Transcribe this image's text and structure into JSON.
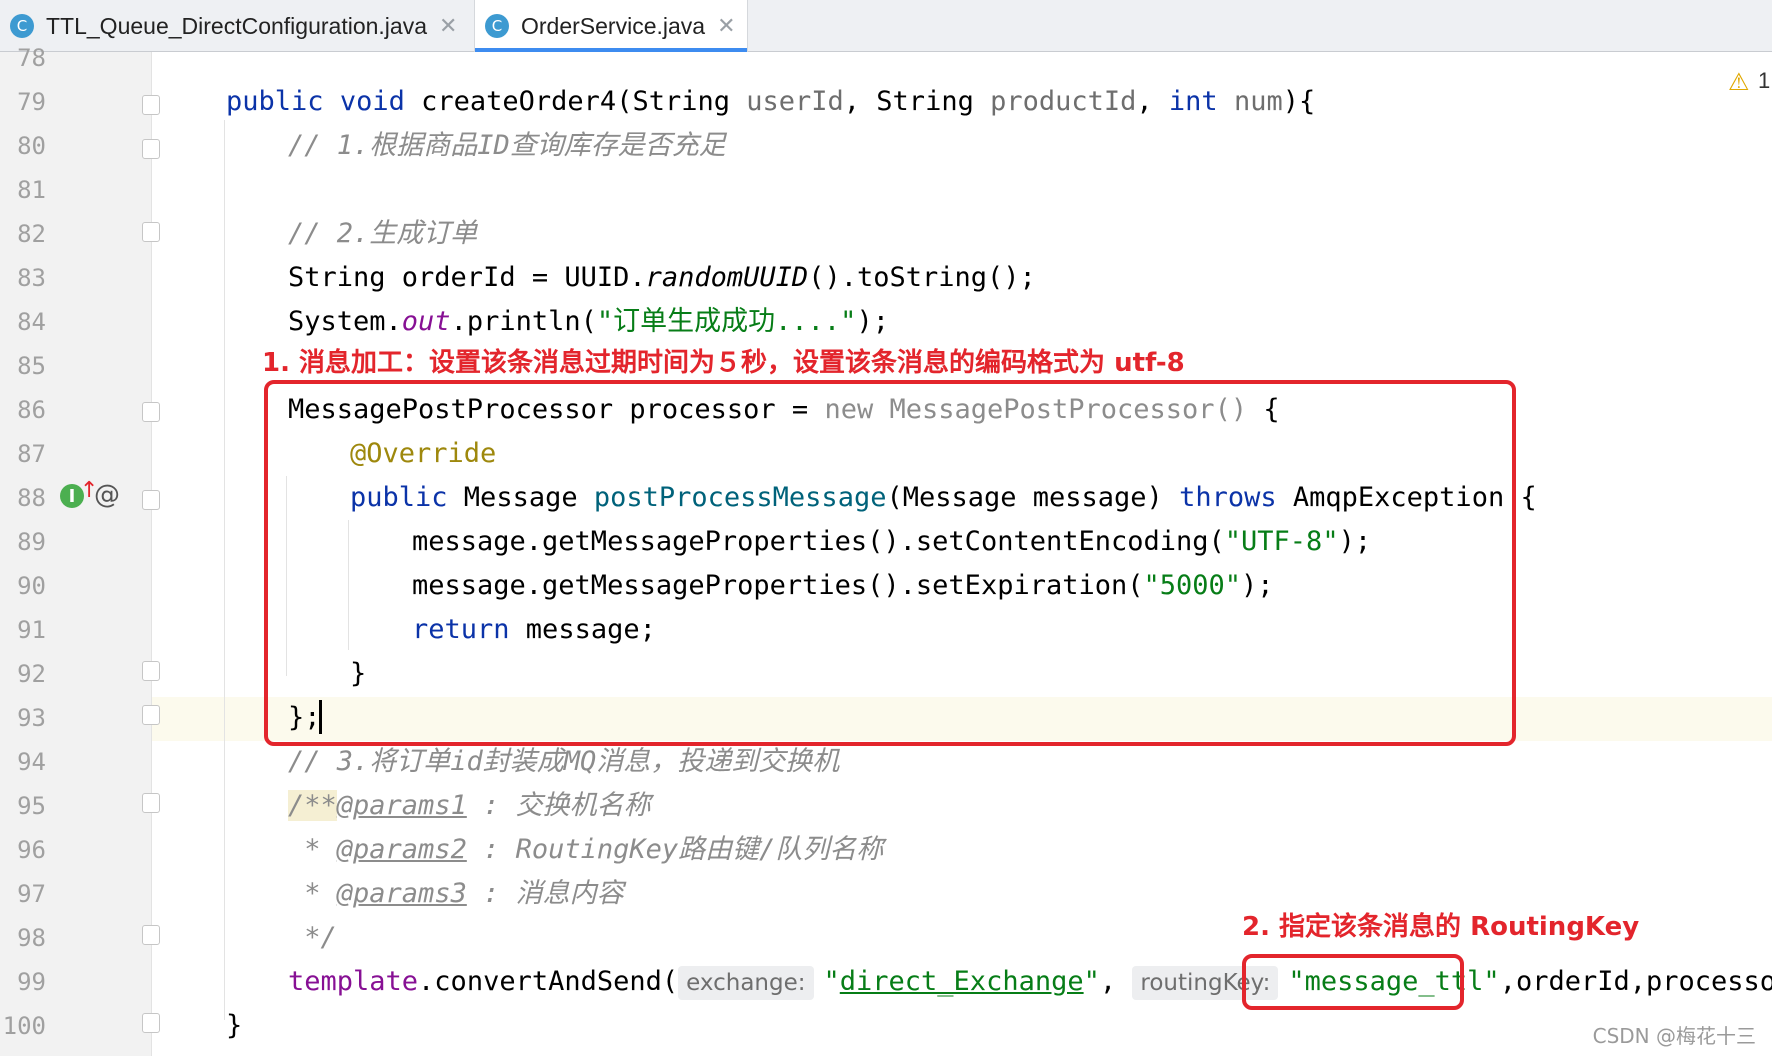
{
  "tabs": [
    {
      "icon_letter": "C",
      "label": "TTL_Queue_DirectConfiguration.java",
      "close": "✕"
    },
    {
      "icon_letter": "C",
      "label": "OrderService.java",
      "close": "✕"
    }
  ],
  "warning": {
    "icon": "⚠",
    "count": "1"
  },
  "line_numbers": [
    "78",
    "79",
    "80",
    "81",
    "82",
    "83",
    "84",
    "85",
    "86",
    "87",
    "88",
    "89",
    "90",
    "91",
    "92",
    "93",
    "94",
    "95",
    "96",
    "97",
    "98",
    "99",
    "100"
  ],
  "code": {
    "l79": {
      "kw1": "public",
      "kw2": "void",
      "name": "createOrder4",
      "p1": "(String ",
      "a1": "userId",
      ",": ", ",
      "t2": "String ",
      "a2": "productId",
      "c2": ", ",
      "kw3": "int",
      "a3": " num",
      "end": "){"
    },
    "l80": "// 1.根据商品ID查询库存是否充足",
    "l82": "// 2.生成订单",
    "l83": {
      "a": "String orderId = UUID.",
      "b": "randomUUID",
      "c": "().toString();"
    },
    "l84": {
      "a": "System.",
      "b": "out",
      "c": ".println(",
      "d": "\"订单生成成功....\"",
      "e": ");"
    },
    "l86": {
      "a": "MessagePostProcessor processor = ",
      "b": "new MessagePostProcessor() ",
      "c": "{"
    },
    "l87": "@Override",
    "l88": {
      "kw": "public",
      "a": " Message ",
      "m": "postProcessMessage",
      "b": "(Message message) ",
      "kw2": "throws",
      "c": " AmqpException {"
    },
    "l89": {
      "a": "message.getMessageProperties().setContentEncoding(",
      "s": "\"UTF-8\"",
      "b": ");"
    },
    "l90": {
      "a": "message.getMessageProperties().setExpiration(",
      "s": "\"5000\"",
      "b": ");"
    },
    "l91": {
      "kw": "return",
      "a": " message;"
    },
    "l92": "}",
    "l93": "};",
    "l94": "// 3.将订单id封装成MQ消息，投递到交换机",
    "l95": {
      "a": "/**",
      "t": "@params1",
      "b": " : 交换机名称"
    },
    "l96": {
      "a": " * ",
      "t": "@params2",
      "b": " : RoutingKey路由键/队列名称"
    },
    "l97": {
      "a": " * ",
      "t": "@params3",
      "b": " : 消息内容"
    },
    "l98": " */",
    "l99": {
      "a": "template",
      "b": ".convertAndSend(",
      "h1": "exchange:",
      "s1q": "\"",
      "s1": "direct_Exchange",
      "s1e": "\"",
      ",": ", ",
      "h2": "routingKey:",
      "s2": "\"message_ttl\"",
      "c": ",orderId,processor);"
    },
    "l100": "}"
  },
  "annotations": {
    "note1": "1. 消息加工：设置该条消息过期时间为５秒，设置该条消息的编码格式为 utf-8",
    "note2": "2. 指定该条消息的 RoutingKey"
  },
  "gutter_icons": {
    "implement": "I↑",
    "at": "@"
  },
  "watermark": "CSDN @梅花十三",
  "colors": {
    "keyword": "#0b33a8",
    "string": "#077d17",
    "comment": "#8c8c8c",
    "annotation": "#9e880d",
    "method": "#00627a",
    "highlight_red": "#e3252c",
    "tab_accent": "#3d8cf0"
  }
}
